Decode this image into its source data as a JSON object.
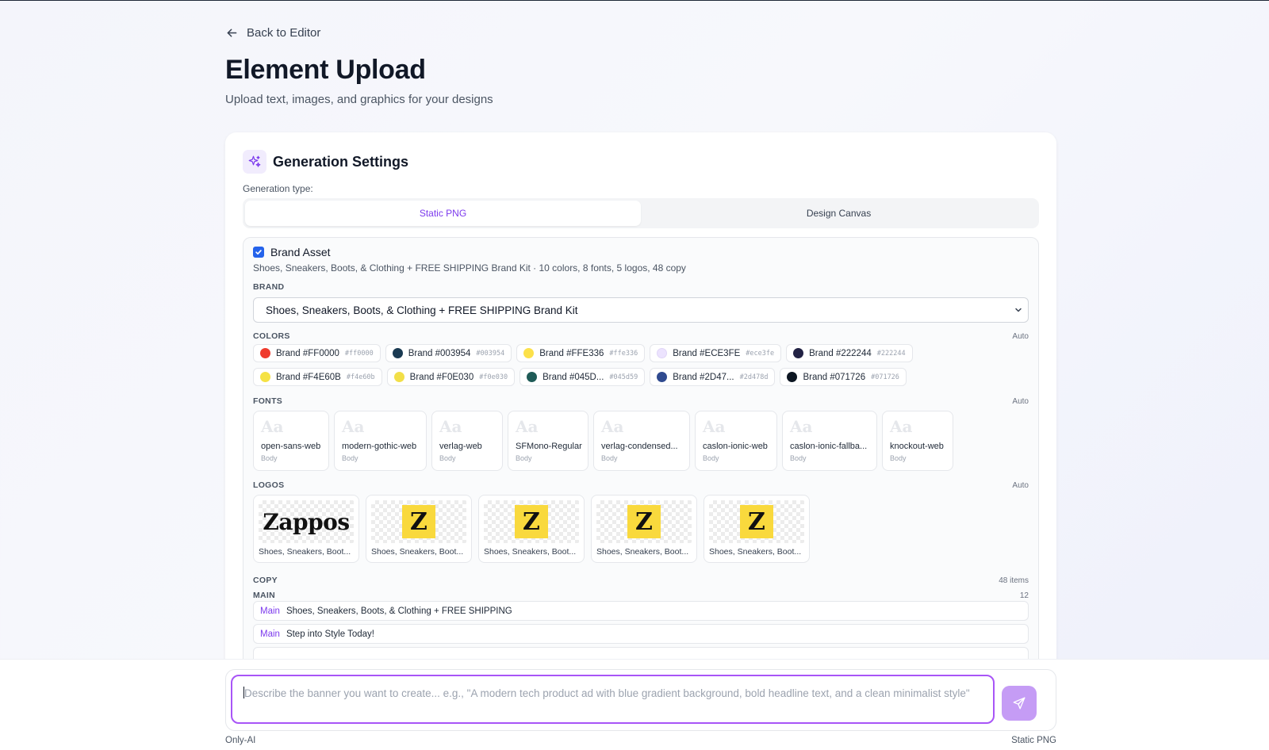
{
  "header": {
    "back_label": "Back to Editor",
    "title": "Element Upload",
    "subtitle": "Upload text, images, and graphics for your designs"
  },
  "settings": {
    "title": "Generation Settings",
    "icon": "sparkles-icon",
    "type_label": "Generation type:",
    "tabs": [
      {
        "label": "Static PNG",
        "active": true
      },
      {
        "label": "Design Canvas",
        "active": false
      }
    ]
  },
  "brand_asset": {
    "checkbox_label": "Brand Asset",
    "checked": true,
    "description": "Shoes, Sneakers, Boots, & Clothing + FREE SHIPPING Brand Kit · 10 colors, 8 fonts, 5 logos, 48 copy",
    "brand_label": "BRAND",
    "brand_value": "Shoes, Sneakers, Boots, & Clothing + FREE SHIPPING Brand Kit",
    "colors": {
      "label": "COLORS",
      "mode": "Auto",
      "items": [
        {
          "name": "Brand #FF0000",
          "hex": "#ff0000",
          "swatch": "#ef3b2d"
        },
        {
          "name": "Brand #003954",
          "hex": "#003954",
          "swatch": "#1a3a52"
        },
        {
          "name": "Brand #FFE336",
          "hex": "#ffe336",
          "swatch": "#fce14a"
        },
        {
          "name": "Brand #ECE3FE",
          "hex": "#ece3fe",
          "swatch": "#ece3fe"
        },
        {
          "name": "Brand #222244",
          "hex": "#222244",
          "swatch": "#222244"
        },
        {
          "name": "Brand #F4E60B",
          "hex": "#f4e60b",
          "swatch": "#f5e244"
        },
        {
          "name": "Brand #F0E030",
          "hex": "#f0e030",
          "swatch": "#f2df48"
        },
        {
          "name": "Brand #045D...",
          "hex": "#045d59",
          "swatch": "#1f5b57"
        },
        {
          "name": "Brand #2D47...",
          "hex": "#2d478d",
          "swatch": "#2f4a8f"
        },
        {
          "name": "Brand #071726",
          "hex": "#071726",
          "swatch": "#0d1622"
        }
      ]
    },
    "fonts": {
      "label": "FONTS",
      "mode": "Auto",
      "sample": "Aa",
      "items": [
        {
          "name": "open-sans-web",
          "role": "Body"
        },
        {
          "name": "modern-gothic-web",
          "role": "Body"
        },
        {
          "name": "verlag-web",
          "role": "Body"
        },
        {
          "name": "SFMono-Regular",
          "role": "Body"
        },
        {
          "name": "verlag-condensed...",
          "role": "Body"
        },
        {
          "name": "caslon-ionic-web",
          "role": "Body"
        },
        {
          "name": "caslon-ionic-fallba...",
          "role": "Body"
        },
        {
          "name": "knockout-web",
          "role": "Body"
        }
      ]
    },
    "logos": {
      "label": "LOGOS",
      "mode": "Auto",
      "items": [
        {
          "kind": "wordmark",
          "mark": "Zappos",
          "name": "Shoes, Sneakers, Boot..."
        },
        {
          "kind": "z",
          "mark": "Z",
          "name": "Shoes, Sneakers, Boot..."
        },
        {
          "kind": "z",
          "mark": "Z",
          "name": "Shoes, Sneakers, Boot..."
        },
        {
          "kind": "z",
          "mark": "Z",
          "name": "Shoes, Sneakers, Boot..."
        },
        {
          "kind": "z",
          "mark": "Z",
          "name": "Shoes, Sneakers, Boot..."
        }
      ]
    },
    "copy": {
      "label": "COPY",
      "count": "48 items",
      "group_label": "MAIN",
      "group_count": "12",
      "items": [
        {
          "tag": "Main",
          "text": "Shoes, Sneakers, Boots, & Clothing + FREE SHIPPING"
        },
        {
          "tag": "Main",
          "text": "Step into Style Today!"
        }
      ]
    }
  },
  "prompt": {
    "placeholder": "Describe the banner you want to create... e.g., \"A modern tech product ad with blue gradient background, bold headline text, and a clean minimalist style\"",
    "send_icon": "send-icon"
  },
  "footer": {
    "left": "Only-AI",
    "right": "Static PNG"
  }
}
